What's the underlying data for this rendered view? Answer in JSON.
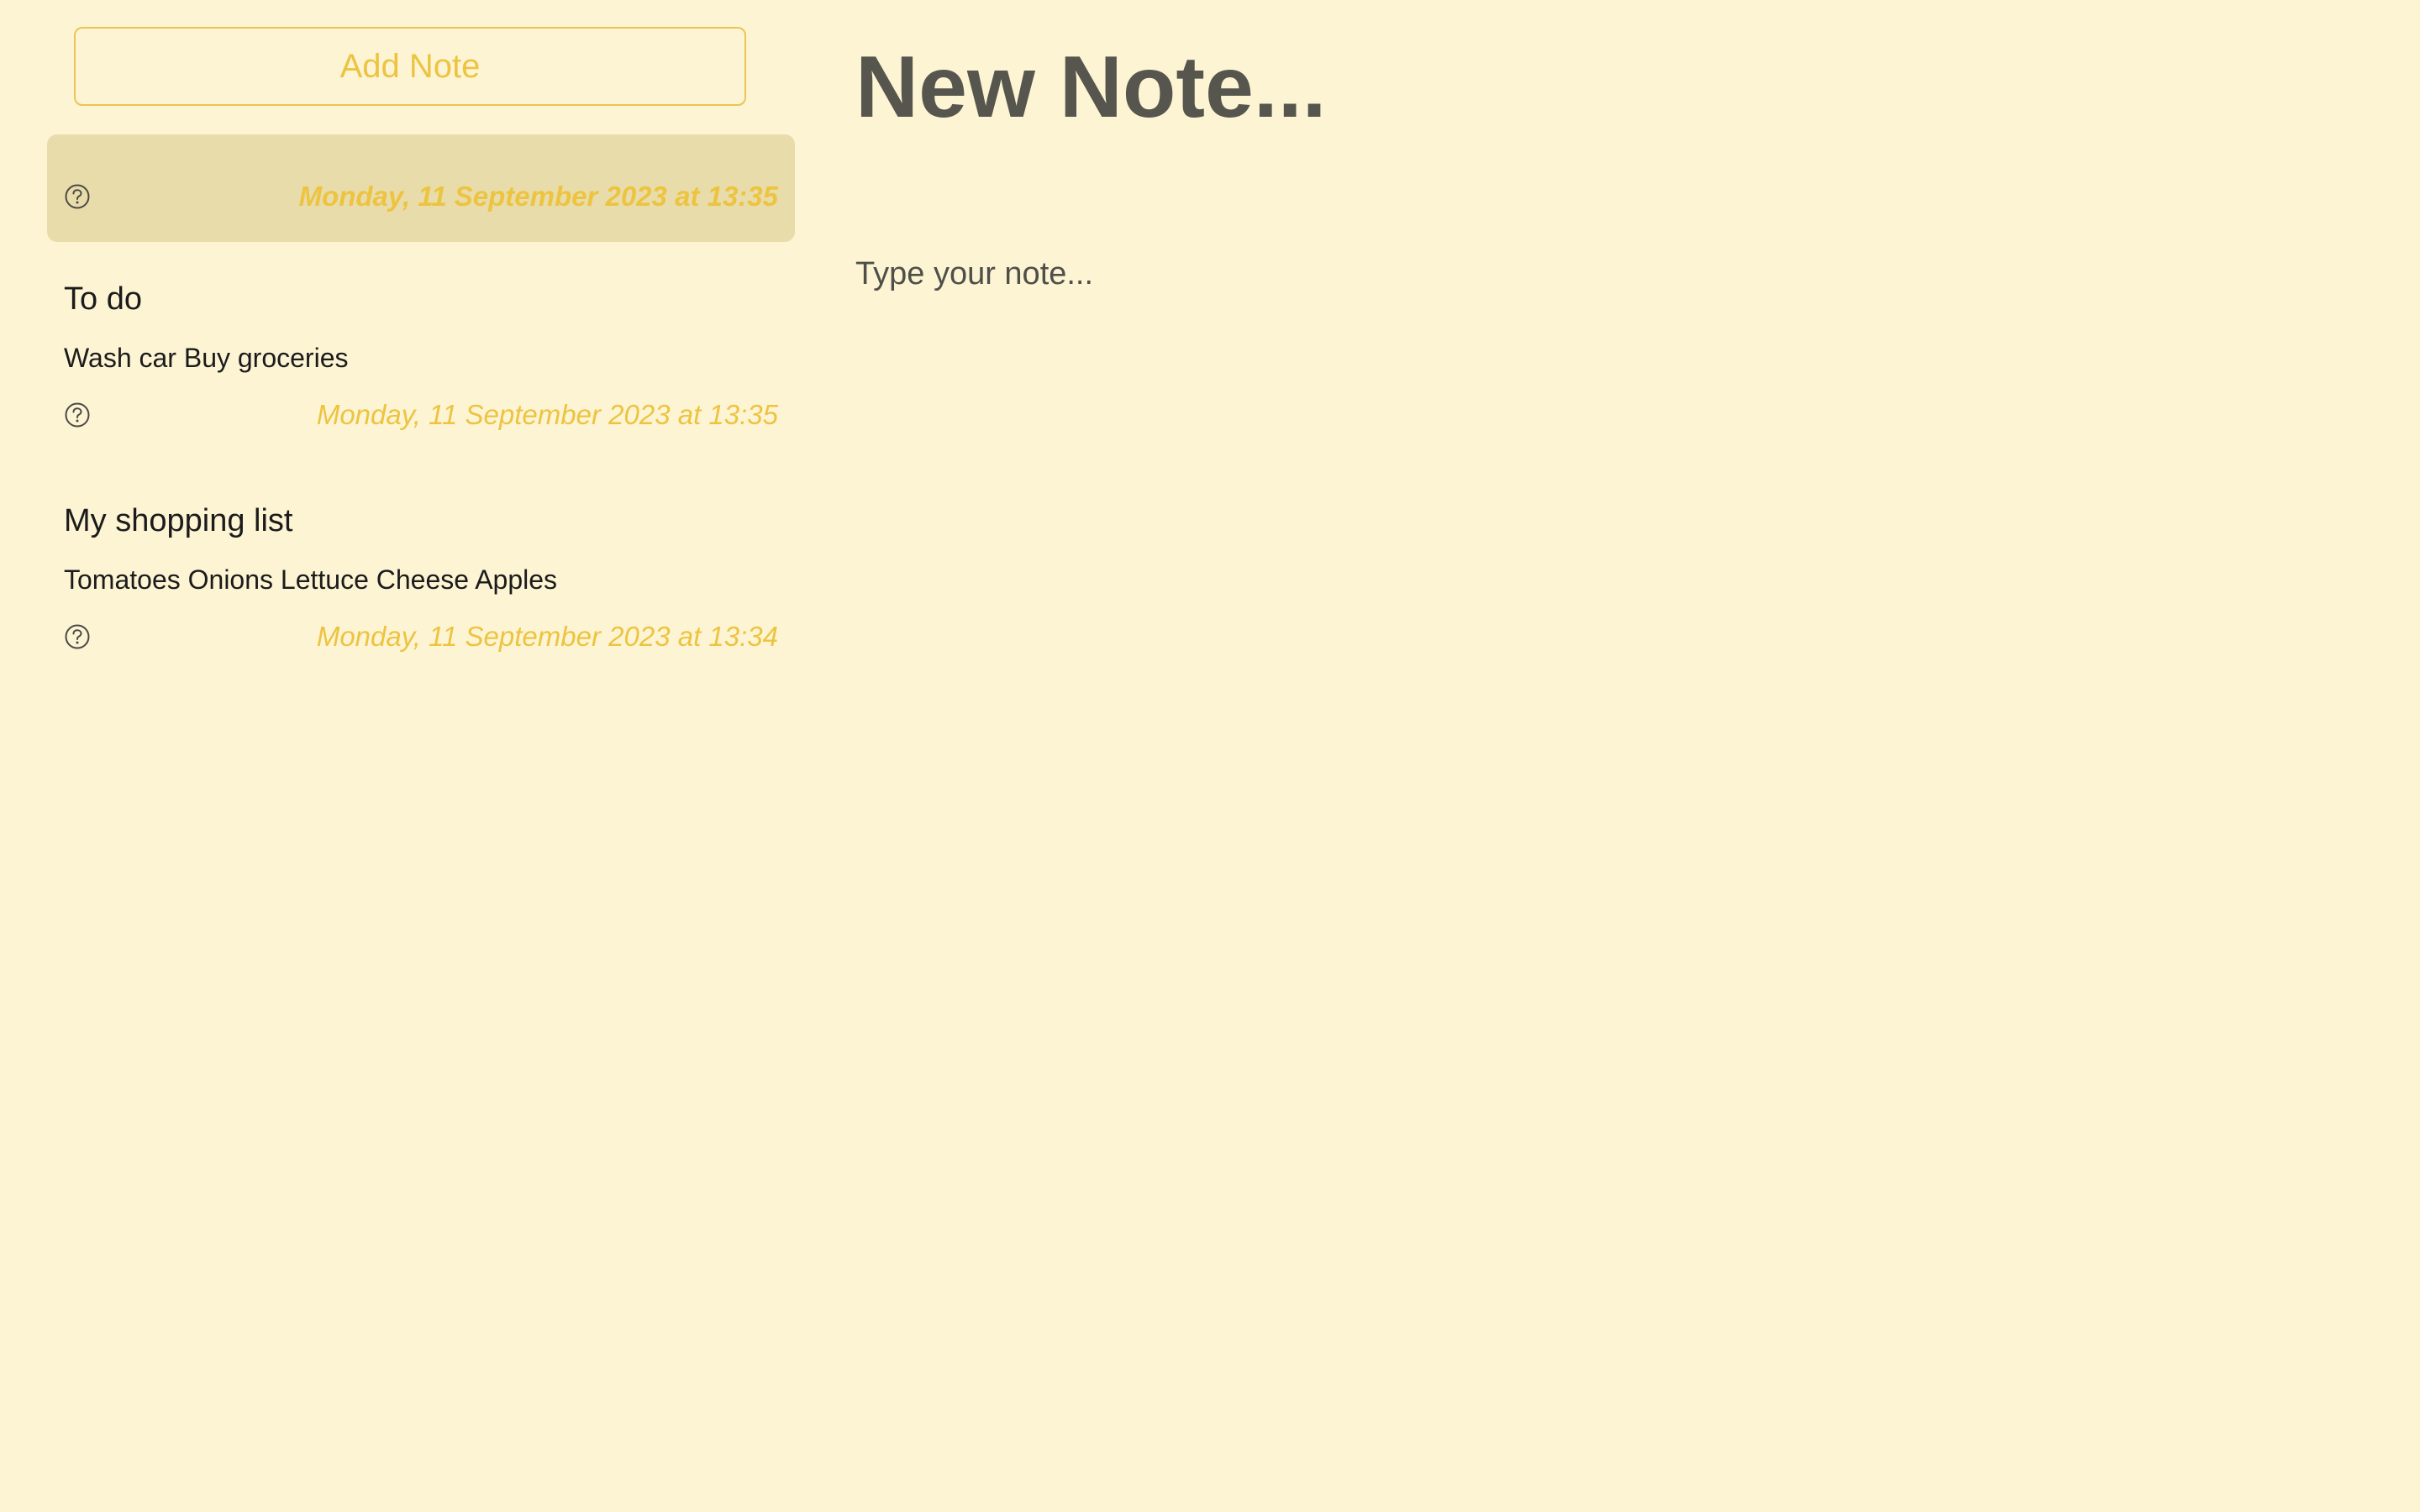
{
  "sidebar": {
    "add_note_label": "Add Note",
    "notes": [
      {
        "title": "",
        "preview": "",
        "date": "Monday, 11 September 2023 at 13:35",
        "icon": "help-circle-icon",
        "selected": true
      },
      {
        "title": "To do",
        "preview": "Wash car Buy groceries",
        "date": "Monday, 11 September 2023 at 13:35",
        "icon": "help-circle-icon",
        "selected": false
      },
      {
        "title": "My shopping list",
        "preview": "Tomatoes Onions Lettuce Cheese Apples",
        "date": "Monday, 11 September 2023 at 13:34",
        "icon": "help-circle-icon",
        "selected": false
      }
    ]
  },
  "editor": {
    "title_placeholder": "New Note...",
    "body_placeholder": "Type your note..."
  },
  "colors": {
    "background": "#fdf4d4",
    "accent": "#edc440",
    "selected_row": "#e9dcab",
    "editor_title": "#57564e"
  }
}
